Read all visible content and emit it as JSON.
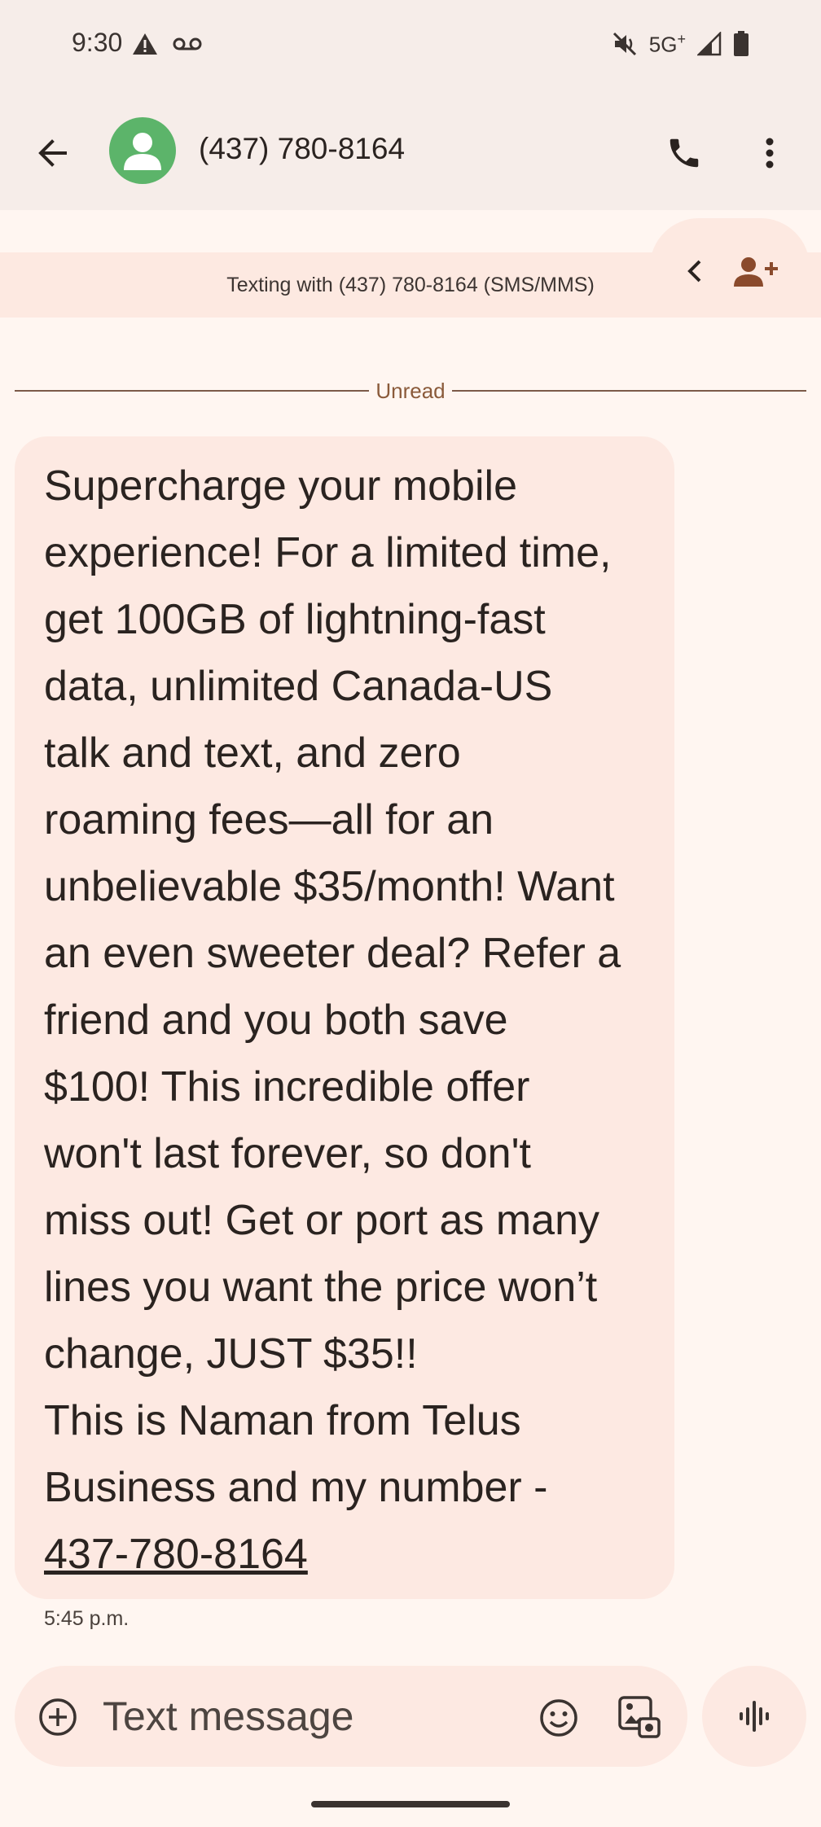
{
  "status_bar": {
    "time": "9:30",
    "network": "5G",
    "network_sup": "+",
    "icons": [
      "alert-triangle-icon",
      "voicemail-icon",
      "mute-icon",
      "signal-icon",
      "battery-icon"
    ]
  },
  "header": {
    "contact_name": "(437) 780-8164",
    "icons": [
      "back-arrow-icon",
      "avatar-person-icon",
      "phone-icon",
      "more-vert-icon"
    ]
  },
  "banner": {
    "text": "Texting with (437) 780-8164 (SMS/MMS)",
    "icons": [
      "chevron-left-icon",
      "add-contact-icon"
    ]
  },
  "conversation": {
    "unread_label": "Unread",
    "message": {
      "body": "Supercharge your mobile\nexperience! For a limited time,\nget 100GB of lightning-fast\ndata, unlimited Canada-US\ntalk and text, and zero\nroaming fees—all for an\nunbelievable $35/month! Want\nan even sweeter deal? Refer a\nfriend and you both save\n$100! This incredible offer\nwon't last forever, so don't\nmiss out! Get or port as many\nlines you want the price won’t\nchange, JUST $35!!\nThis is Naman from Telus\nBusiness and my number -\n",
      "link": "437-780-8164",
      "time": "5:45 p.m."
    }
  },
  "composer": {
    "placeholder": "Text message",
    "icons": [
      "add-circle-icon",
      "emoji-icon",
      "gallery-icon",
      "voice-wave-icon"
    ]
  },
  "colors": {
    "header_bg": "#f6ede9",
    "bubble_bg": "#fde9e2",
    "avatar": "#5cb46a",
    "accent": "#8a5a3a"
  }
}
